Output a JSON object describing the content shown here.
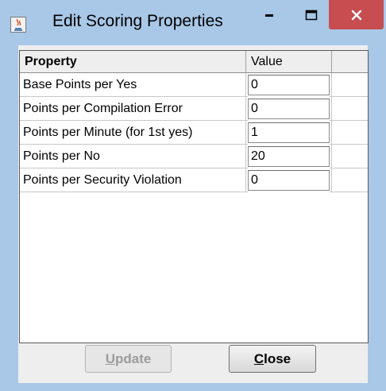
{
  "window": {
    "title": "Edit Scoring Properties",
    "icon": "java-icon"
  },
  "table": {
    "columns": [
      "Property",
      "Value",
      ""
    ],
    "rows": [
      {
        "property": "Base Points per Yes",
        "value": "0"
      },
      {
        "property": "Points per Compilation Error",
        "value": "0"
      },
      {
        "property": "Points per Minute (for 1st yes)",
        "value": "1"
      },
      {
        "property": "Points per No",
        "value": "20"
      },
      {
        "property": "Points per Security Violation",
        "value": "0"
      }
    ]
  },
  "buttons": {
    "update": {
      "mnemonic": "U",
      "rest": "pdate",
      "enabled": false
    },
    "close": {
      "mnemonic": "C",
      "rest": "lose",
      "enabled": true
    }
  },
  "colors": {
    "frame": "#a9c8e8",
    "close_button": "#c74d50",
    "panel": "#eeeeee"
  }
}
